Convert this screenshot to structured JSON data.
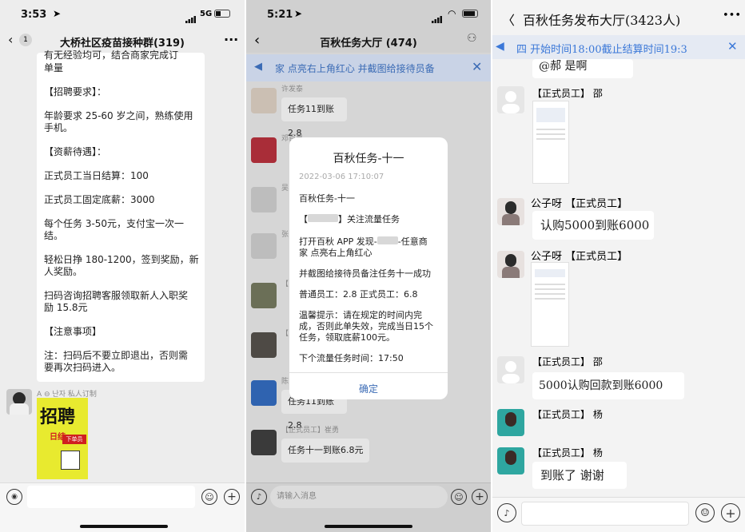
{
  "panel1": {
    "time": "3:53",
    "network": "5G",
    "back_count": "1",
    "title": "大桥社区疫苗接种群(319)",
    "more": "···",
    "lines": [
      "有无经验均可，结合商家完成订",
      "单量",
      "【招聘要求】：",
      "年龄要求 25-60 岁之间，熟练使用",
      "手机。",
      "【资薪待遇】：",
      "正式员工当日结算：100",
      "正式员工固定底薪：3000",
      "每个任务 3-50元，支付宝一次一",
      "结。",
      "轻松日挣 180-1200，签到奖励，新",
      "人奖励。",
      "扫码咨询招聘客服领取新人入职奖",
      "励 15.8元",
      "【注意事项】",
      "注：扫码后不要立即退出，否则需",
      "要再次扫码进入。"
    ],
    "sender": "A  ⊖ 난자 私人订制",
    "poster_top": "招聘",
    "poster_mid": "日结",
    "poster_badge": "下单员"
  },
  "panel2": {
    "time": "5:21",
    "title": "百秋任务大厅 (474)",
    "notice": "家  点亮右上角红心    并截图给接待员备",
    "msgs": [
      {
        "name": "许发泰",
        "text": "任务11到账2.8"
      },
      {
        "name": "邓百灵",
        "text": ""
      },
      {
        "name": "吴",
        "text": ""
      },
      {
        "name": "张",
        "text": ""
      },
      {
        "name": "【",
        "text": ""
      },
      {
        "name": "【",
        "text": ""
      },
      {
        "name": "陈",
        "text": "任务11到账2.8"
      },
      {
        "name": "【正式员工】崔勇",
        "text": "任务十一到账6.8元"
      }
    ],
    "dialog": {
      "title": "百秋任务-十一",
      "date": "2022-03-06 17:10:07",
      "l1": "百秋任务-十一",
      "l2a": "【",
      "l2b": "】关注流量任务",
      "l3a": "打开百秋 APP 发现-",
      "l3b": "-任意商",
      "l3c": "家  点亮右上角红心",
      "l4": "并截图给接待员备注任务十一成功",
      "l5": "普通员工：2.8  正式员工：6.8",
      "l6": "温馨提示：请在规定的时间内完",
      "l7": "成，否则此单失效，完成当日15个",
      "l8": "任务，领取底薪100元。",
      "l9": "下个流量任务时间：17:50",
      "ok": "确定"
    },
    "input_placeholder": "请输入消息"
  },
  "panel3": {
    "title": "百秋任务发布大厅(3423人)",
    "back": "〈",
    "more": "•••",
    "notice": "四  开始时间18:00截止结算时间19:3",
    "msgs": [
      {
        "name": "",
        "text": "@郝      是啊"
      },
      {
        "name": "【正式员工】 邵",
        "text": ""
      },
      {
        "name": "公子呀  【正式员工】",
        "text": "认购5000到账6000"
      },
      {
        "name": "公子呀  【正式员工】",
        "text": ""
      },
      {
        "name": "【正式员工】 邵",
        "text": "5000认购回款到账6000"
      },
      {
        "name": "【正式员工】 杨",
        "text": ""
      },
      {
        "name": "【正式员工】 杨",
        "text": "到账了   谢谢"
      }
    ]
  }
}
